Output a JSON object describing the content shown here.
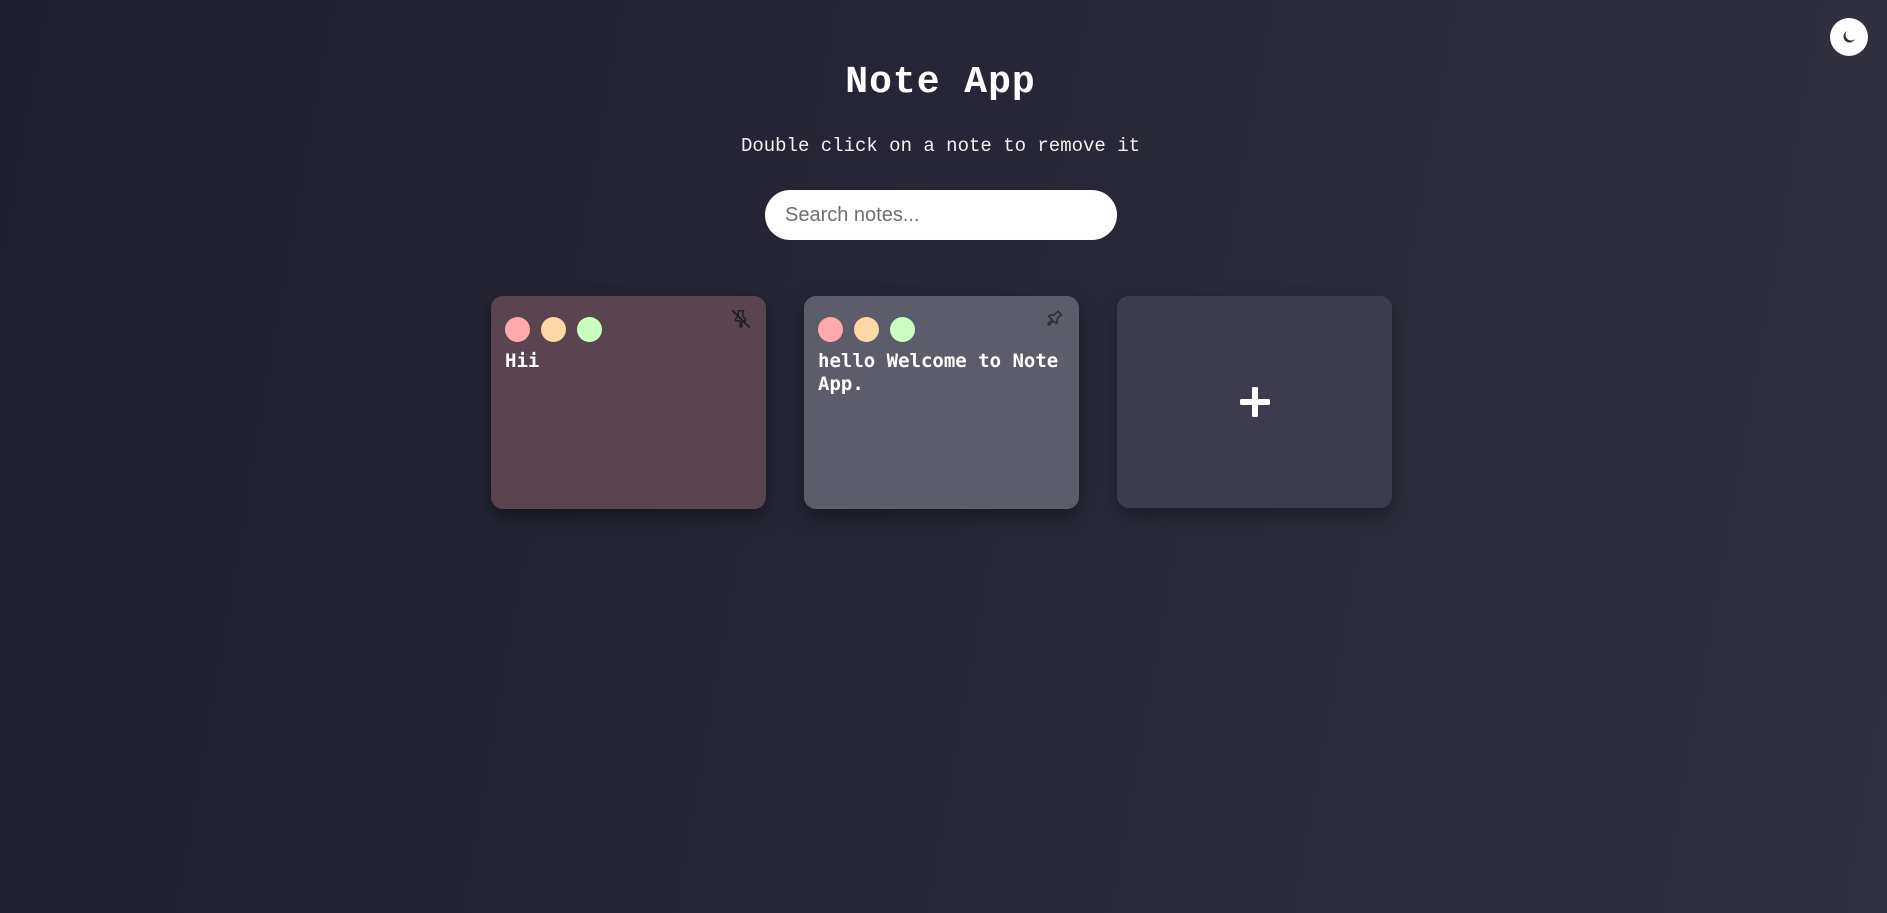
{
  "app": {
    "title": "Note App",
    "subtitle": "Double click on a note to remove it"
  },
  "theme_toggle": {
    "icon": "moon-icon"
  },
  "search": {
    "placeholder": "Search notes...",
    "value": ""
  },
  "notes": [
    {
      "text": "Hii",
      "background": "#5a4450",
      "pinned": true,
      "pin_icon": "pin-off-icon"
    },
    {
      "text": "hello Welcome to Note App.",
      "background": "#5c5c6a",
      "pinned": false,
      "pin_icon": "pin-icon"
    }
  ],
  "color_options": [
    "#ffaaaa",
    "#ffd6a5",
    "#caffbf"
  ],
  "add_note": {
    "icon": "plus-icon",
    "background": "#3d3c4c"
  }
}
